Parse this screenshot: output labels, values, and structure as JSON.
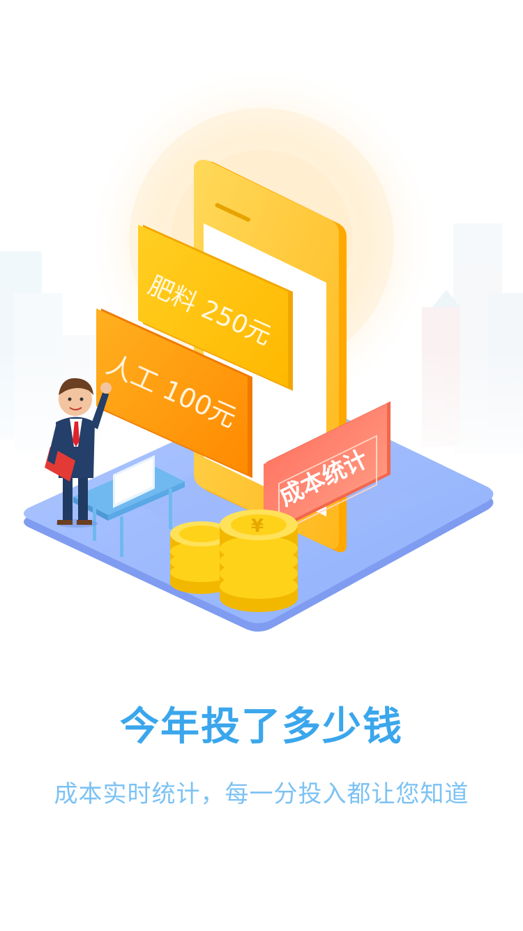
{
  "illustration": {
    "tag_fertilizer": "肥料 250元",
    "tag_labor": "人工 100元",
    "tag_cost_stats": "成本统计",
    "coin_symbol": "¥",
    "colors": {
      "platform": "#9cb8fb",
      "platform_edge": "#7f9cf0",
      "phone": "#ffcd3a",
      "tag_orange": "#ff9a1a",
      "tag_yellow": "#ffc21c",
      "tag_red": "#ff7d61",
      "coin": "#f7cf1b",
      "sun_glow": "#fff2da"
    }
  },
  "headline": "今年投了多少钱",
  "subtitle": "成本实时统计，每一分投入都让您知道",
  "colors": {
    "headline": "#3aa6ec",
    "subtitle": "#7cc2f3"
  }
}
